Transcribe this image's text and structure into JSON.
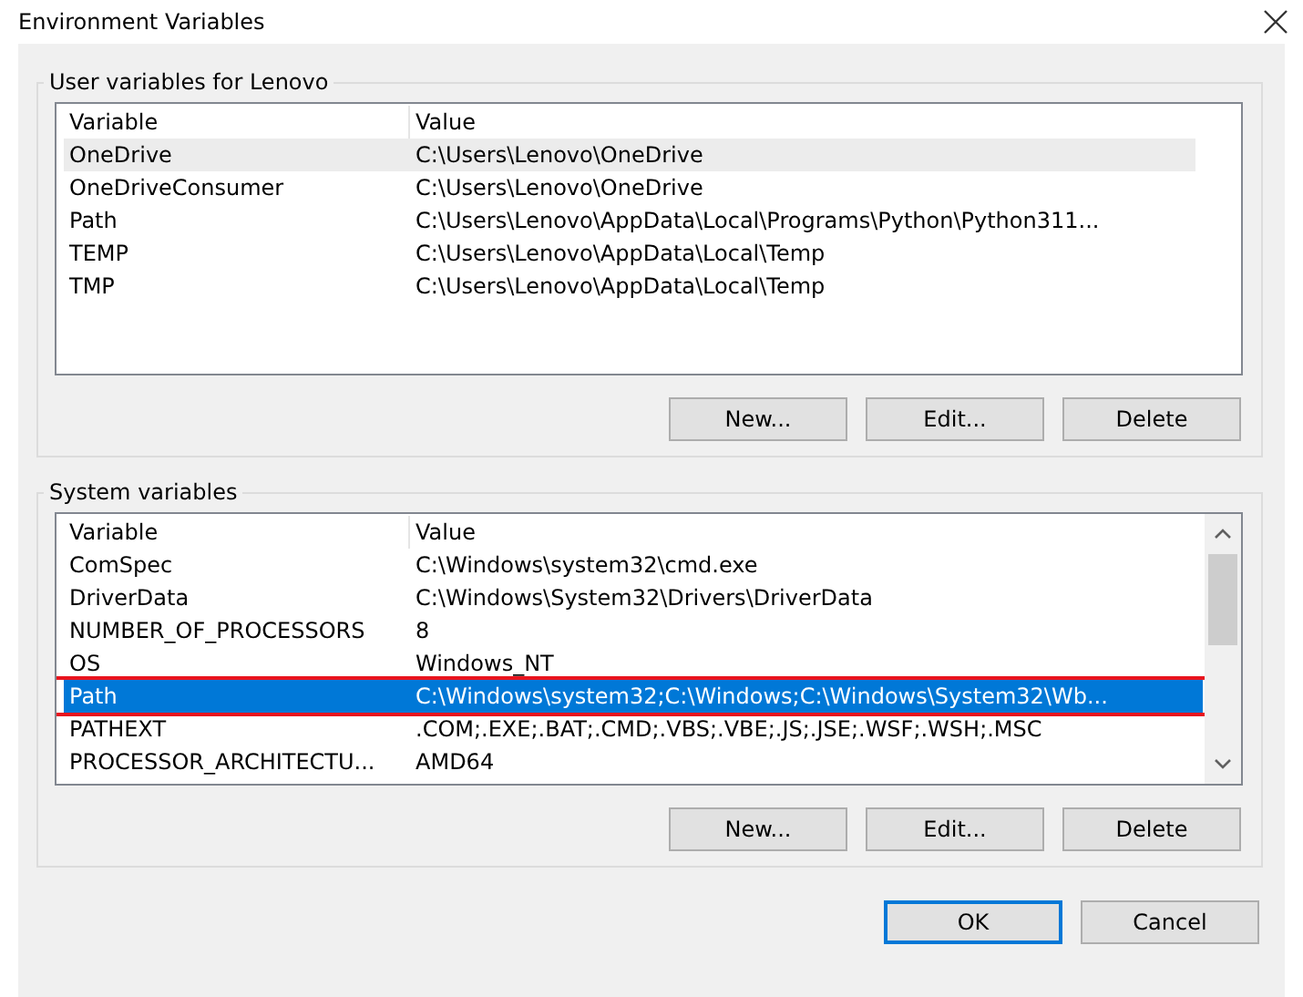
{
  "window": {
    "title": "Environment Variables"
  },
  "user_variables": {
    "title": "User variables for Lenovo",
    "focused": false,
    "columns": [
      "Variable",
      "Value"
    ],
    "rows": [
      {
        "variable": "OneDrive",
        "value": "C:\\Users\\Lenovo\\OneDrive",
        "selected": true
      },
      {
        "variable": "OneDriveConsumer",
        "value": "C:\\Users\\Lenovo\\OneDrive",
        "selected": false
      },
      {
        "variable": "Path",
        "value": "C:\\Users\\Lenovo\\AppData\\Local\\Programs\\Python\\Python311...",
        "selected": false
      },
      {
        "variable": "TEMP",
        "value": "C:\\Users\\Lenovo\\AppData\\Local\\Temp",
        "selected": false
      },
      {
        "variable": "TMP",
        "value": "C:\\Users\\Lenovo\\AppData\\Local\\Temp",
        "selected": false
      }
    ],
    "buttons": [
      "New...",
      "Edit...",
      "Delete"
    ]
  },
  "system_variables": {
    "title": "System variables",
    "focused": true,
    "columns": [
      "Variable",
      "Value"
    ],
    "rows": [
      {
        "variable": "ComSpec",
        "value": "C:\\Windows\\system32\\cmd.exe",
        "selected": false,
        "highlighted": false
      },
      {
        "variable": "DriverData",
        "value": "C:\\Windows\\System32\\Drivers\\DriverData",
        "selected": false,
        "highlighted": false
      },
      {
        "variable": "NUMBER_OF_PROCESSORS",
        "value": "8",
        "selected": false,
        "highlighted": false
      },
      {
        "variable": "OS",
        "value": "Windows_NT",
        "selected": false,
        "highlighted": false
      },
      {
        "variable": "Path",
        "value": "C:\\Windows\\system32;C:\\Windows;C:\\Windows\\System32\\Wb...",
        "selected": true,
        "highlighted": true
      },
      {
        "variable": "PATHEXT",
        "value": ".COM;.EXE;.BAT;.CMD;.VBS;.VBE;.JS;.JSE;.WSF;.WSH;.MSC",
        "selected": false,
        "highlighted": false
      },
      {
        "variable": "PROCESSOR_ARCHITECTU...",
        "value": "AMD64",
        "selected": false,
        "highlighted": false
      }
    ],
    "buttons": [
      "New...",
      "Edit...",
      "Delete"
    ]
  },
  "dialog_buttons": [
    {
      "label": "OK",
      "default": true
    },
    {
      "label": "Cancel",
      "default": false
    }
  ]
}
